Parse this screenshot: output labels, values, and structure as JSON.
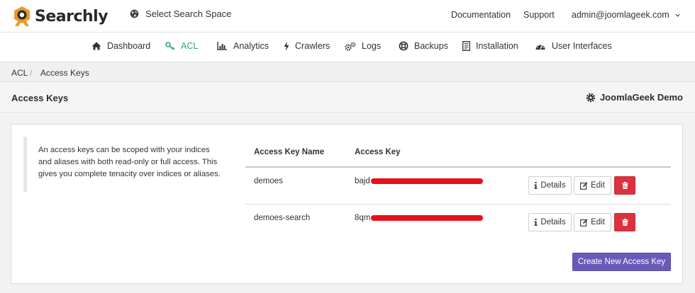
{
  "app": {
    "name": "Searchly"
  },
  "header": {
    "space_label": "Select Search Space",
    "documentation": "Documentation",
    "support": "Support",
    "user_email": "admin@joomlageek.com"
  },
  "nav": [
    {
      "label": "Dashboard",
      "icon": "home-icon"
    },
    {
      "label": "ACL",
      "icon": "key-icon",
      "active": true
    },
    {
      "label": "Analytics",
      "icon": "bar-chart-icon"
    },
    {
      "label": "Crawlers",
      "icon": "bolt-icon"
    },
    {
      "label": "Logs",
      "icon": "cogs-icon"
    },
    {
      "label": "Backups",
      "icon": "life-ring-icon"
    },
    {
      "label": "Installation",
      "icon": "document-icon"
    },
    {
      "label": "User Interfaces",
      "icon": "dashboard-gauge-icon"
    }
  ],
  "breadcrumb": {
    "parent": "ACL",
    "separator": "/",
    "current": "Access Keys"
  },
  "page": {
    "title": "Access Keys",
    "account": "JoomlaGeek Demo"
  },
  "description": "An access keys can be scoped with your indices and aliases with both read-only or full access. This gives you complete tenacity over indices or aliases.",
  "table": {
    "headers": [
      "Access Key Name",
      "Access Key"
    ],
    "rows": [
      {
        "name": "demoes",
        "key_prefix": "bajd",
        "key_redacted": true
      },
      {
        "name": "demoes-search",
        "key_prefix": "8qm",
        "key_redacted": true
      }
    ],
    "actions": {
      "details": "Details",
      "edit": "Edit",
      "delete_icon": "trash-icon"
    }
  },
  "create_button": "Create New Access Key",
  "colors": {
    "accent": "#3a9e7d",
    "danger": "#d9333f",
    "primary": "#6a5ab8",
    "redaction": "#e8101a"
  }
}
